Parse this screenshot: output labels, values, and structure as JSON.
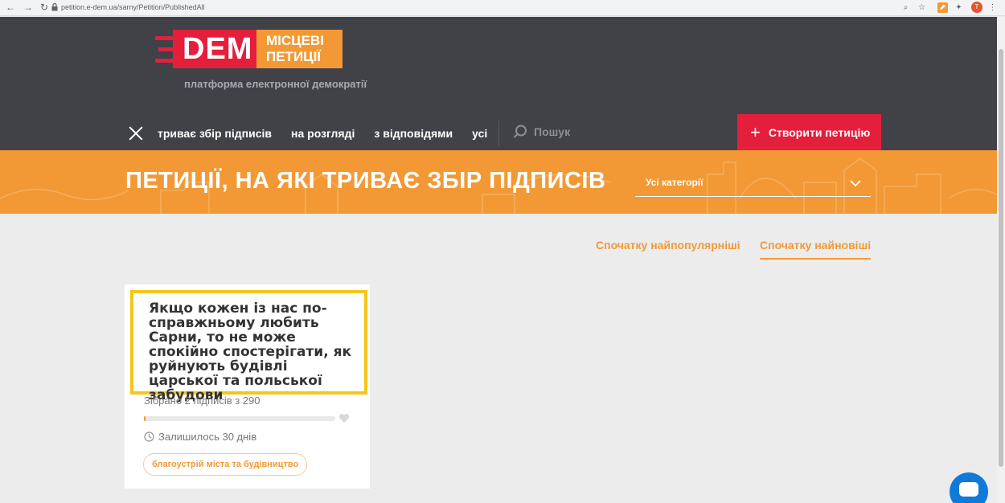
{
  "browser": {
    "url": "petition.e-dem.ua/sarny/Petition/PublishedAll",
    "profile_initial": "T"
  },
  "logo": {
    "dem": "DEM",
    "line1": "МІСЦЕВІ",
    "line2": "ПЕТИЦІЇ",
    "tagline": "платформа електронної демократії"
  },
  "menu": {
    "items": [
      {
        "label": "триває збір підписів"
      },
      {
        "label": "на розгляді"
      },
      {
        "label": "з відповідями"
      },
      {
        "label": "усі"
      }
    ],
    "search_placeholder": "Пошук",
    "create_label": "Створити петицію"
  },
  "banner": {
    "title": "ПЕТИЦІЇ, НА ЯКІ ТРИВАЄ ЗБІР ПІДПИСІВ",
    "category_select": "Усі категорії"
  },
  "sort": {
    "popular": "Спочатку найпопулярніші",
    "newest": "Спочатку найновіші"
  },
  "petitions": [
    {
      "title": "Якщо кожен із нас по-справжньому любить Сарни, то не може спокійно спостерігати, як руйнують будівлі царської та польської забудови",
      "signed_text": "Зібрано 2 підписів з 290",
      "progress_fraction": 0.007,
      "days_left": "Залишилось 30 днів",
      "tag": "благоустрій міста та будівництво"
    }
  ],
  "colors": {
    "header": "#414148",
    "accent_red": "#e31f3c",
    "accent_orange": "#f29935",
    "highlight": "#f5c518"
  }
}
